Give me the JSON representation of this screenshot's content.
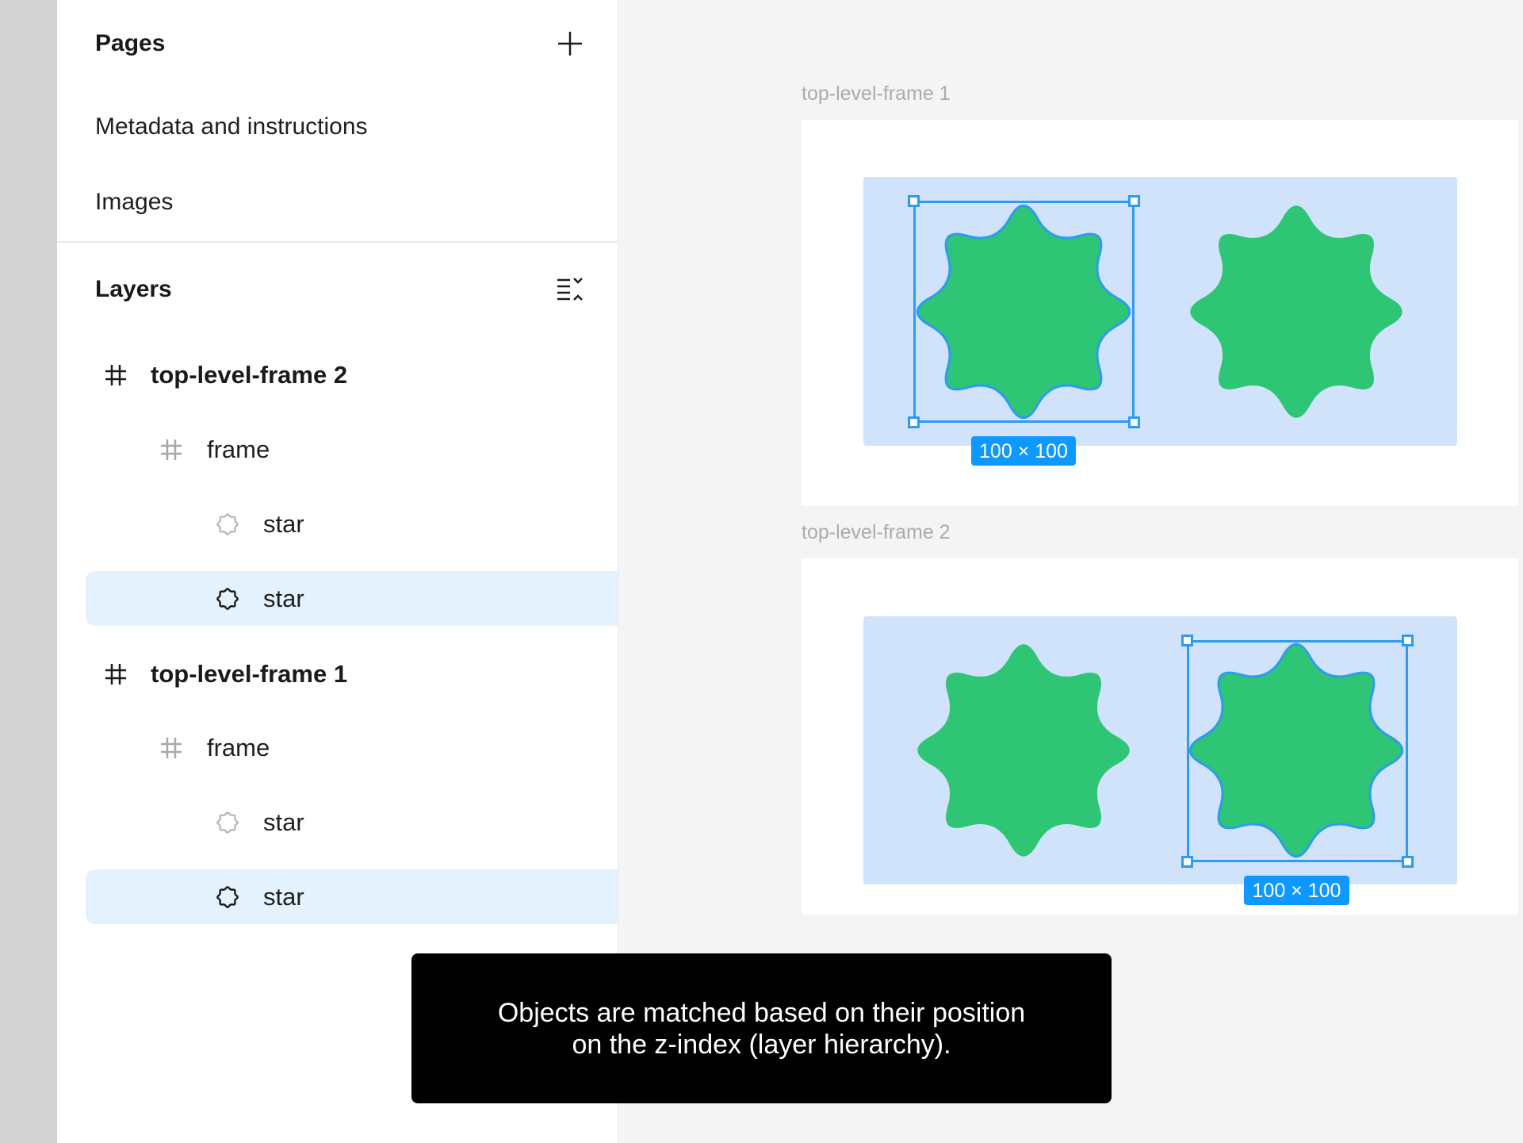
{
  "pages": {
    "title": "Pages",
    "add_icon": "plus-icon",
    "items": [
      {
        "label": "Metadata and instructions"
      },
      {
        "label": "Images"
      }
    ]
  },
  "layers": {
    "title": "Layers",
    "collapse_icon": "collapse-layers-icon",
    "items": [
      {
        "label": "top-level-frame 2",
        "type": "frame",
        "depth": 0,
        "selected": false
      },
      {
        "label": "frame",
        "type": "frame",
        "depth": 1,
        "selected": false
      },
      {
        "label": "star",
        "type": "star",
        "depth": 2,
        "selected": false
      },
      {
        "label": "star",
        "type": "star",
        "depth": 2,
        "selected": true
      },
      {
        "label": "top-level-frame 1",
        "type": "frame",
        "depth": 0,
        "selected": false
      },
      {
        "label": "frame",
        "type": "frame",
        "depth": 1,
        "selected": false
      },
      {
        "label": "star",
        "type": "star",
        "depth": 2,
        "selected": false
      },
      {
        "label": "star",
        "type": "star",
        "depth": 2,
        "selected": true
      }
    ]
  },
  "canvas": {
    "frames": [
      {
        "label": "top-level-frame 1",
        "selected_star_index": 0,
        "dimensions": "100 × 100"
      },
      {
        "label": "top-level-frame 2",
        "selected_star_index": 1,
        "dimensions": "100 × 100"
      }
    ]
  },
  "colors": {
    "star_fill": "#2ec574",
    "selection": "#2d9bf0",
    "inner_frame": "#d1e2fb",
    "badge": "#0d99ff",
    "layer_highlight": "#e3f2fd"
  },
  "caption": {
    "line1": "Objects are matched based on their position",
    "line2": "on the z-index (layer hierarchy)."
  }
}
